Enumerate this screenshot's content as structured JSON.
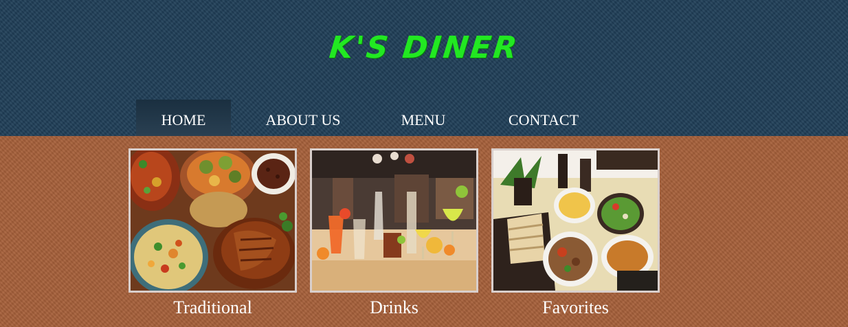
{
  "site": {
    "logo": "K'S DINER"
  },
  "nav": {
    "items": [
      {
        "label": "HOME",
        "active": true
      },
      {
        "label": "ABOUT US",
        "active": false
      },
      {
        "label": "MENU",
        "active": false
      },
      {
        "label": "CONTACT",
        "active": false
      }
    ]
  },
  "gallery": {
    "items": [
      {
        "caption": "Traditional"
      },
      {
        "caption": "Drinks"
      },
      {
        "caption": "Favorites"
      }
    ]
  },
  "colors": {
    "header_bg": "#203f58",
    "body_bg": "#a6603a",
    "logo": "#22e822",
    "nav_text": "#ffffff",
    "active_nav_bg": "#1e3445"
  }
}
